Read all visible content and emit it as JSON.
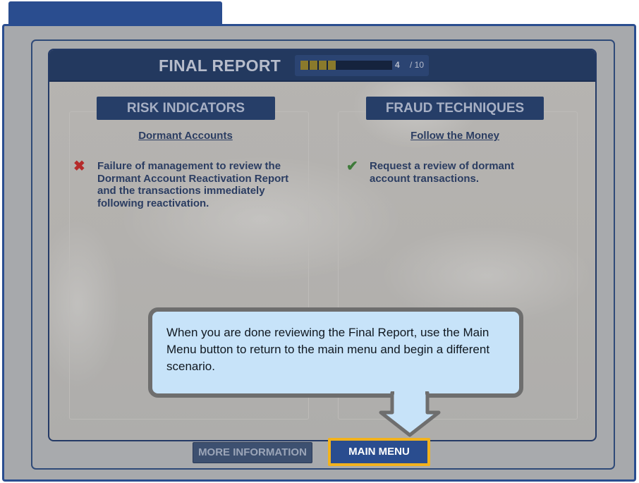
{
  "report": {
    "title": "FINAL REPORT",
    "progress": {
      "current": "4",
      "total": "/ 10",
      "fraction": 0.4,
      "fill_color": "#8a7a2c"
    }
  },
  "risk": {
    "heading": "RISK INDICATORS",
    "subheading": "Dormant Accounts",
    "icon": "x-mark-icon",
    "text": "Failure of management to review the Dormant Account Reactivation Report and the transactions immediately following reactivation."
  },
  "fraud": {
    "heading": "FRAUD TECHNIQUES",
    "subheading": "Follow the Money",
    "icon": "checkmark-icon",
    "text": "Request a review of dormant account transactions."
  },
  "footer": {
    "more_info_label": "MORE INFORMATION",
    "main_menu_label": "MAIN MENU"
  },
  "callout": {
    "text": "When you are done reviewing the Final Report, use the Main Menu button to return to the main menu and begin a different scenario."
  },
  "colors": {
    "navy": "#23395f",
    "accent_blue": "#2a4d8f",
    "highlight_border": "#f2b21d",
    "callout_fill": "#c7e3f9",
    "error_red": "#b52a2a",
    "success_green": "#3e7a3a"
  }
}
